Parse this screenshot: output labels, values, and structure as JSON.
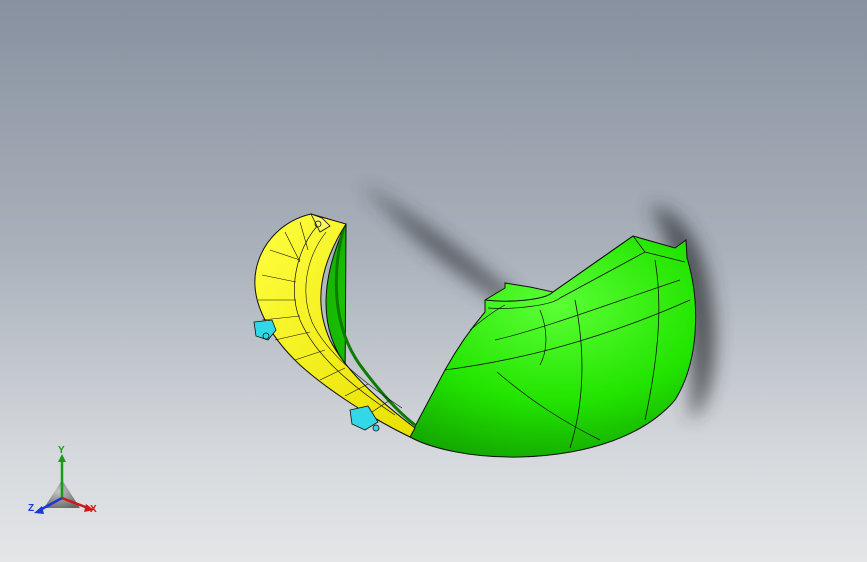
{
  "viewport": {
    "background_top": "#87919f",
    "background_bottom": "#e4e6e8"
  },
  "part": {
    "outer_color": "#22e400",
    "inner_color": "#f2f000",
    "clip_color": "#33d8e8",
    "edge_color": "#101010"
  },
  "triad": {
    "x_label": "X",
    "y_label": "Y",
    "z_label": "Z",
    "x_color": "#d01818",
    "y_color": "#1a9a1a",
    "z_color": "#1a3ad0"
  }
}
